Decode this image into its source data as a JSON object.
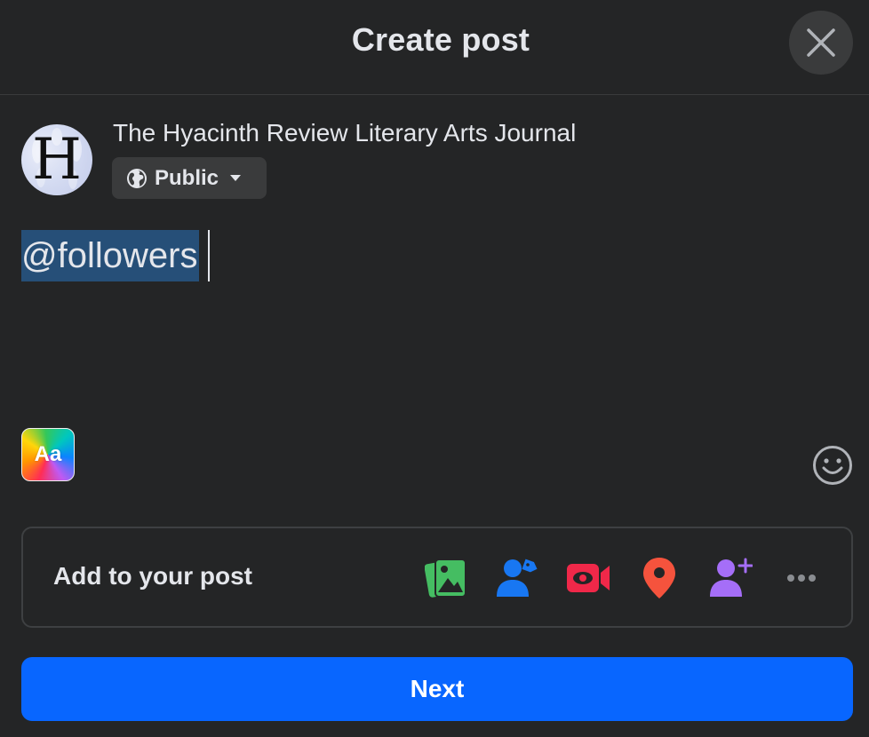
{
  "dialog": {
    "title": "Create post",
    "close_icon": "close-icon"
  },
  "author": {
    "avatar_letter": "H",
    "page_name": "The Hyacinth Review Literary Arts Journal",
    "audience": {
      "label": "Public",
      "icon": "globe-icon",
      "dropdown_icon": "caret-down-icon"
    }
  },
  "composer": {
    "highlighted_text": "@followers"
  },
  "text_style": {
    "label": "Aa"
  },
  "add_to_post": {
    "label": "Add to your post",
    "icons": [
      "photo-video-icon",
      "tag-people-icon",
      "live-video-icon",
      "check-in-icon",
      "add-collaborator-icon",
      "more-icon"
    ]
  },
  "next_button": {
    "label": "Next"
  },
  "colors": {
    "background": "#242526",
    "surface": "#3a3b3c",
    "primary": "#0866ff",
    "photo_green": "#45bd62",
    "tag_blue": "#1877f2",
    "live_red": "#f02849",
    "checkin_orange": "#f5533d",
    "collab_purple": "#a56ef8"
  }
}
